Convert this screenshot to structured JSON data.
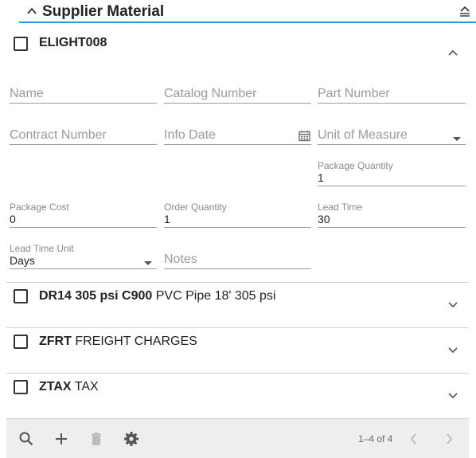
{
  "header": {
    "title": "Supplier Material",
    "accent_color": "#2196f3",
    "collapse_icon": "chevron-up-icon",
    "collapse_all_icon": "collapse-all-icon"
  },
  "items": [
    {
      "code": "ELIGHT008",
      "description": "",
      "expanded": true
    },
    {
      "code": "DR14 305 psi C900",
      "description": " PVC Pipe 18' 305 psi",
      "expanded": false
    },
    {
      "code": "ZFRT",
      "description": " FREIGHT CHARGES",
      "expanded": false
    },
    {
      "code": "ZTAX",
      "description": " TAX",
      "expanded": false
    }
  ],
  "form": {
    "name_placeholder": "Name",
    "catalog_number_placeholder": "Catalog Number",
    "part_number_placeholder": "Part Number",
    "contract_number_placeholder": "Contract Number",
    "info_date_placeholder": "Info Date",
    "unit_of_measure_placeholder": "Unit of Measure",
    "package_quantity_label": "Package Quantity",
    "package_quantity_value": "1",
    "package_cost_label": "Package Cost",
    "package_cost_value": "0",
    "order_quantity_label": "Order Quantity",
    "order_quantity_value": "1",
    "lead_time_label": "Lead Time",
    "lead_time_value": "30",
    "lead_time_unit_label": "Lead Time Unit",
    "lead_time_unit_value": "Days",
    "notes_placeholder": "Notes"
  },
  "footer": {
    "pager_text": "1–4 of 4",
    "icons": [
      "search-icon",
      "add-icon",
      "delete-icon",
      "settings-icon",
      "chevron-left-icon",
      "chevron-right-icon"
    ]
  }
}
